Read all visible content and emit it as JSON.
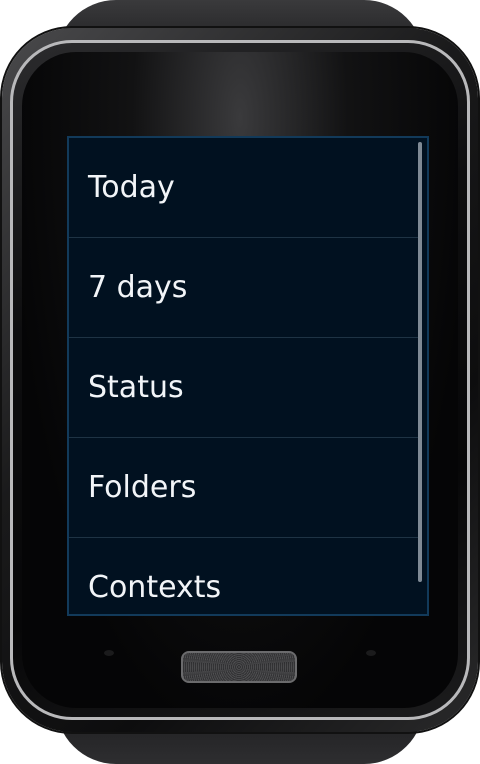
{
  "menu": {
    "items": [
      {
        "label": "Today"
      },
      {
        "label": "7 days"
      },
      {
        "label": "Status"
      },
      {
        "label": "Folders"
      },
      {
        "label": "Contexts"
      }
    ]
  },
  "colors": {
    "screen_background": "#011120",
    "text": "#f2f5f8",
    "divider": "#1e3344"
  }
}
